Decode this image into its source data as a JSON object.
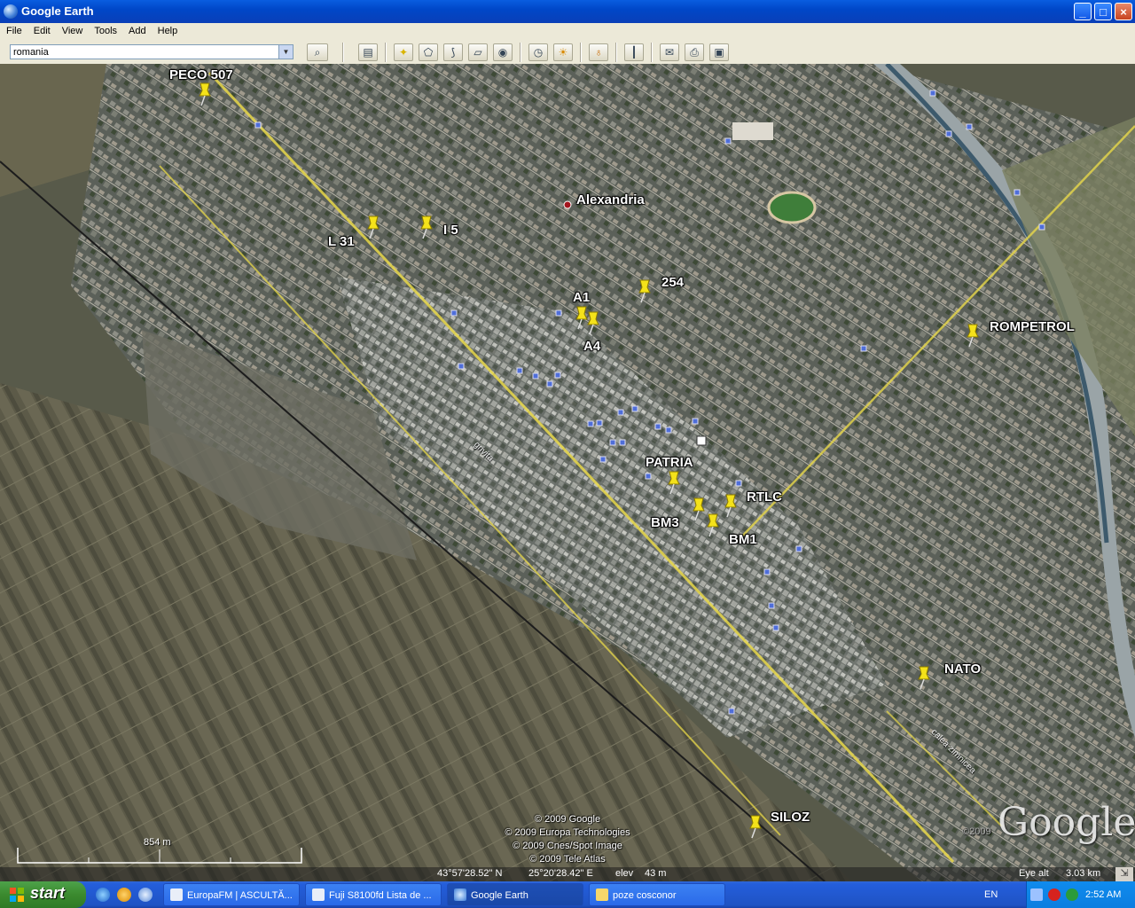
{
  "window": {
    "title": "Google Earth"
  },
  "menu": [
    "File",
    "Edit",
    "View",
    "Tools",
    "Add",
    "Help"
  ],
  "search": {
    "value": "romania"
  },
  "toolbar": {
    "icons": [
      "search-icon",
      "sidebar-icon",
      "placemark-icon",
      "polygon-icon",
      "path-icon",
      "image-overlay-icon",
      "record-tour-icon",
      "historical-imagery-icon",
      "sunlight-icon",
      "planets-icon",
      "ruler-icon",
      "email-icon",
      "print-icon",
      "save-image-icon"
    ]
  },
  "map": {
    "city_label": "Alexandria",
    "placemarks": [
      "PECO 507",
      "L 31",
      "I 5",
      "254",
      "A1",
      "A4",
      "ROMPETROL",
      "PATRIA",
      "RTLC",
      "BM3",
      "BM1",
      "NATO",
      "SILOZ"
    ],
    "streets": [
      "grivita",
      "calea zimnicea"
    ],
    "scale": "854 m",
    "copyright": [
      "© 2009 Google",
      "© 2009 Europa Technologies",
      "© 2009 Cnes/Spot Image",
      "© 2009 Tele Atlas"
    ],
    "logo": "Google",
    "logo_copy": "©2009"
  },
  "status": {
    "lat": "43°57'28.52\" N",
    "lon": "25°20'28.42\" E",
    "elev_label": "elev",
    "elev": "43 m",
    "eye_label": "Eye alt",
    "eye": "3.03 km"
  },
  "taskbar": {
    "start": "start",
    "tasks": [
      "EuropaFM | ASCULTĂ...",
      "Fuji S8100fd Lista de ...",
      "Google Earth",
      "poze cosconor"
    ],
    "lang": "EN",
    "clock": "2:52 AM"
  },
  "colors": {
    "titlebar": "#0a5de0",
    "road": "#e8d84a",
    "pin": "#f4e21a"
  }
}
